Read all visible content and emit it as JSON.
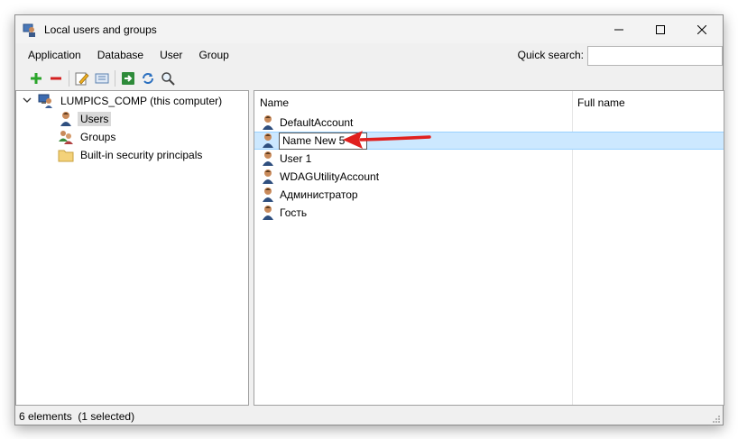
{
  "window": {
    "title": "Local users and groups",
    "controls": {
      "minimize_icon": "minimize-icon",
      "maximize_icon": "maximize-icon",
      "close_icon": "close-icon"
    }
  },
  "menu": {
    "items": [
      "Application",
      "Database",
      "User",
      "Group"
    ],
    "quick_search_label": "Quick search:",
    "quick_search_value": ""
  },
  "toolbar": {
    "buttons": [
      "add-icon",
      "remove-icon",
      "edit-icon",
      "properties-icon",
      "export-icon",
      "refresh-icon",
      "search-icon"
    ]
  },
  "tree": {
    "root": "LUMPICS_COMP (this computer)",
    "children": [
      {
        "label": "Users",
        "icon": "user-icon",
        "selected": true
      },
      {
        "label": "Groups",
        "icon": "group-icon",
        "selected": false
      },
      {
        "label": "Built-in security principals",
        "icon": "folder-icon",
        "selected": false
      }
    ]
  },
  "list": {
    "columns": [
      "Name",
      "Full name"
    ],
    "rows": [
      {
        "name": "DefaultAccount",
        "full_name": ""
      },
      {
        "name": "Name New 5",
        "full_name": "",
        "editing": true
      },
      {
        "name": "User 1",
        "full_name": ""
      },
      {
        "name": "WDAGUtilityAccount",
        "full_name": ""
      },
      {
        "name": "Администратор",
        "full_name": ""
      },
      {
        "name": "Гость",
        "full_name": ""
      }
    ]
  },
  "status": {
    "text": "6 elements  (1 selected)"
  },
  "colors": {
    "selection": "#cce8ff",
    "annotation_arrow": "#e0201e",
    "add": "#2aa52a",
    "remove": "#d42020"
  }
}
